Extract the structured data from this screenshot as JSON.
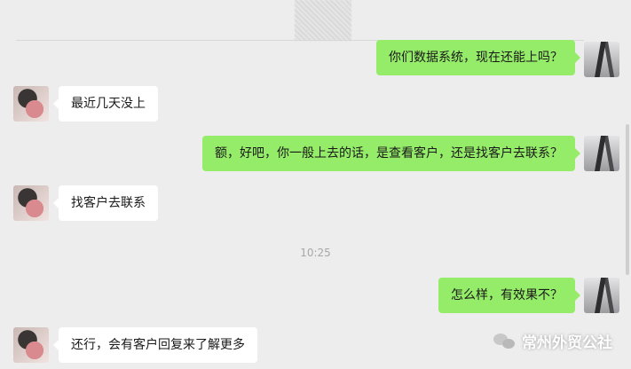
{
  "messages": [
    {
      "side": "right",
      "text": "你们数据系统，现在还能上吗？"
    },
    {
      "side": "left",
      "text": "最近几天没上"
    },
    {
      "side": "right",
      "text": "额，好吧，你一般上去的话，是查看客户，还是找客户去联系？"
    },
    {
      "side": "left",
      "text": "找客户去联系"
    },
    {
      "side": "right",
      "text": "怎么样，有效果不？"
    },
    {
      "side": "left",
      "text": "还行，会有客户回复来了解更多"
    }
  ],
  "timestamp": "10:25",
  "watermark": "常州外贸公社",
  "colors": {
    "background": "#ededed",
    "sent_bubble": "#95ec69",
    "received_bubble": "#ffffff",
    "timestamp": "#a8a8a8"
  },
  "icons": {
    "watermark_logo": "wechat-logo-icon",
    "avatar_self": "building-photo-avatar",
    "avatar_contact": "person-photo-avatar"
  }
}
